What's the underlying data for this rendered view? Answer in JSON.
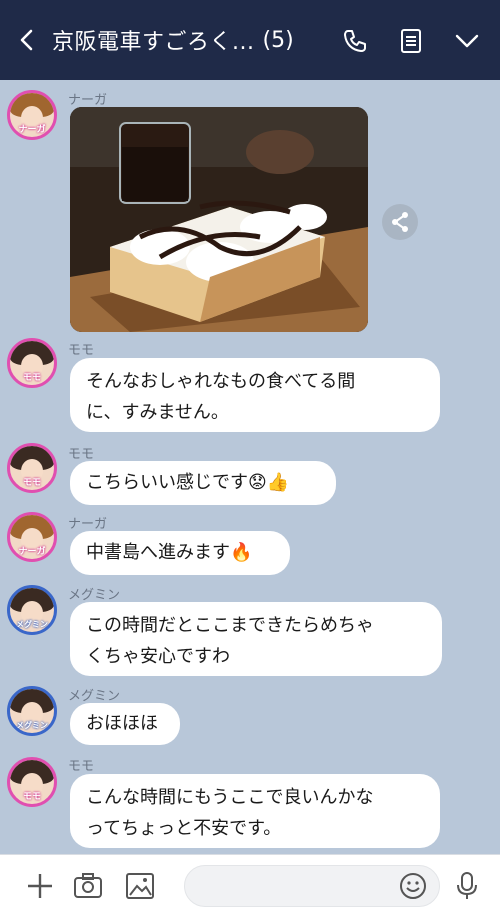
{
  "header": {
    "title": "京阪電車すごろく...",
    "member_count": "(5)"
  },
  "messages": [
    {
      "sender": "ナーガ",
      "avatar_tag": "ナーガ",
      "type": "photo"
    },
    {
      "sender": "モモ",
      "avatar_tag": "モモ",
      "line1": "そんなおしゃれなもの食べてる間",
      "line2": "に、すみません。"
    },
    {
      "sender": "モモ",
      "avatar_tag": "モモ",
      "text": "こちらいい感じです😟👍"
    },
    {
      "sender": "ナーガ",
      "avatar_tag": "ナーガ",
      "text": "中書島へ進みます🔥"
    },
    {
      "sender": "メグミン",
      "avatar_tag": "メグミン",
      "line1": "この時間だとここまできたらめちゃ",
      "line2": "くちゃ安心ですわ"
    },
    {
      "sender": "メグミン",
      "avatar_tag": "メグミン",
      "text": "おほほほ"
    },
    {
      "sender": "モモ",
      "avatar_tag": "モモ",
      "line1": "こんな時間にもうここで良いんかな",
      "line2": "ってちょっと不安です。"
    }
  ],
  "colors": {
    "header_bg": "#1f2a48",
    "chat_bg": "#b8c7d9",
    "bubble_bg": "#ffffff",
    "avatar_ring_pink": "#e04fb0",
    "avatar_ring_blue": "#3a67c9"
  },
  "icons": {
    "header": [
      "back-chevron-icon",
      "phone-icon",
      "notes-icon",
      "chevron-down-icon"
    ],
    "bottom": [
      "plus-icon",
      "camera-icon",
      "image-icon",
      "emoji-icon",
      "microphone-icon"
    ],
    "photo": [
      "share-icon"
    ]
  }
}
